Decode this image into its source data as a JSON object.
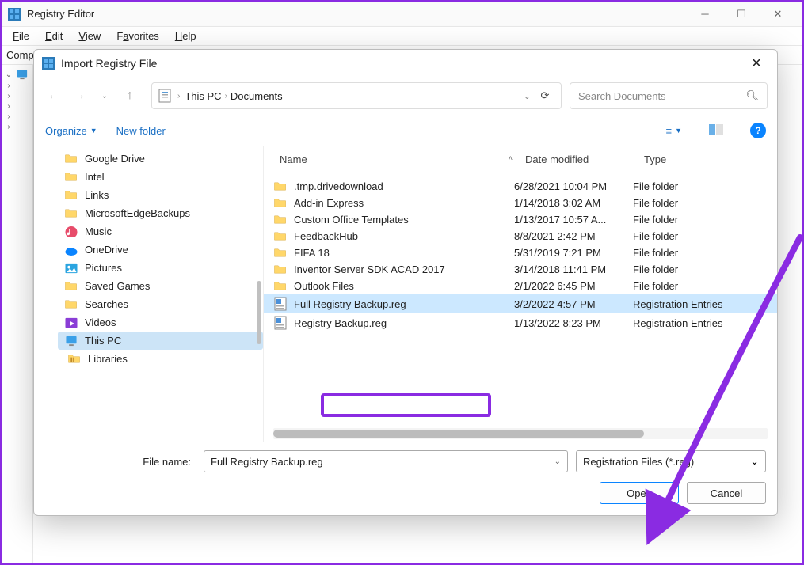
{
  "main_window": {
    "title": "Registry Editor",
    "menu": {
      "file": "File",
      "edit": "Edit",
      "view": "View",
      "favorites": "Favorites",
      "help": "Help"
    },
    "path_prefix": "Comp",
    "tree_root_collapsed": "▾"
  },
  "dialog": {
    "title": "Import Registry File",
    "nav": {
      "crumb1": "This PC",
      "crumb2": "Documents",
      "search_placeholder": "Search Documents"
    },
    "toolbar": {
      "organize": "Organize",
      "new_folder": "New folder"
    },
    "columns": {
      "name": "Name",
      "date": "Date modified",
      "type": "Type"
    },
    "sidebar": [
      {
        "label": "Google Drive",
        "icon": "folder"
      },
      {
        "label": "Intel",
        "icon": "folder"
      },
      {
        "label": "Links",
        "icon": "folder"
      },
      {
        "label": "MicrosoftEdgeBackups",
        "icon": "folder"
      },
      {
        "label": "Music",
        "icon": "music"
      },
      {
        "label": "OneDrive",
        "icon": "onedrive"
      },
      {
        "label": "Pictures",
        "icon": "pictures"
      },
      {
        "label": "Saved Games",
        "icon": "folder"
      },
      {
        "label": "Searches",
        "icon": "folder"
      },
      {
        "label": "Videos",
        "icon": "videos"
      },
      {
        "label": "This PC",
        "icon": "pc",
        "selected": true
      },
      {
        "label": "Libraries",
        "icon": "folder"
      }
    ],
    "files": [
      {
        "name": ".tmp.drivedownload",
        "date": "6/28/2021 10:04 PM",
        "type": "File folder",
        "icon": "folder"
      },
      {
        "name": "Add-in Express",
        "date": "1/14/2018 3:02 AM",
        "type": "File folder",
        "icon": "folder"
      },
      {
        "name": "Custom Office Templates",
        "date": "1/13/2017 10:57 A...",
        "type": "File folder",
        "icon": "folder"
      },
      {
        "name": "FeedbackHub",
        "date": "8/8/2021 2:42 PM",
        "type": "File folder",
        "icon": "folder"
      },
      {
        "name": "FIFA 18",
        "date": "5/31/2019 7:21 PM",
        "type": "File folder",
        "icon": "folder"
      },
      {
        "name": "Inventor Server SDK ACAD 2017",
        "date": "3/14/2018 11:41 PM",
        "type": "File folder",
        "icon": "folder"
      },
      {
        "name": "Outlook Files",
        "date": "2/1/2022 6:45 PM",
        "type": "File folder",
        "icon": "folder"
      },
      {
        "name": "Full Registry Backup.reg",
        "date": "3/2/2022 4:57 PM",
        "type": "Registration Entries",
        "icon": "reg",
        "selected": true
      },
      {
        "name": "Registry Backup.reg",
        "date": "1/13/2022 8:23 PM",
        "type": "Registration Entries",
        "icon": "reg"
      }
    ],
    "footer": {
      "label": "File name:",
      "value": "Full Registry Backup.reg",
      "filter": "Registration Files (*.reg)",
      "open": "Open",
      "cancel": "Cancel"
    }
  }
}
